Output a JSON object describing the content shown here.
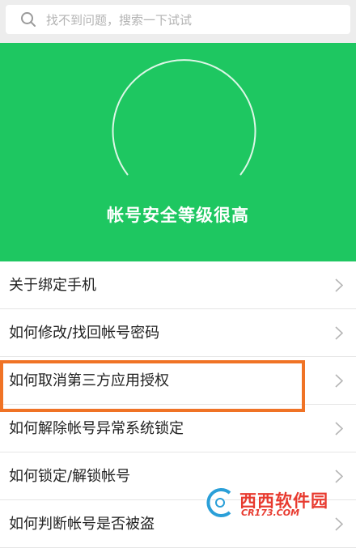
{
  "search": {
    "placeholder": "找不到问题，搜索一下试试"
  },
  "hero": {
    "title": "帐号安全等级很高",
    "bg_color": "#1ec761"
  },
  "faq": {
    "items": [
      {
        "label": "关于绑定手机"
      },
      {
        "label": "如何修改/找回帐号密码"
      },
      {
        "label": "如何取消第三方应用授权",
        "highlighted": true
      },
      {
        "label": "如何解除帐号异常系统锁定"
      },
      {
        "label": "如何锁定/解锁帐号"
      },
      {
        "label": "如何判断帐号是否被盗"
      }
    ],
    "highlight_color": "#f07325"
  },
  "watermark": {
    "brand": "西西软件园",
    "sub": "CR173.COM"
  }
}
